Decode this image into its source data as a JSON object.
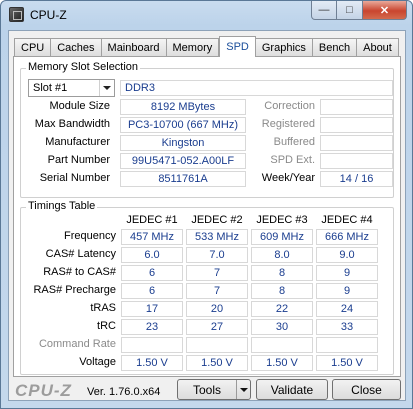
{
  "window": {
    "title": "CPU-Z",
    "min_glyph": "—",
    "max_glyph": "□",
    "close_glyph": "✕"
  },
  "tabs": [
    {
      "label": "CPU"
    },
    {
      "label": "Caches"
    },
    {
      "label": "Mainboard"
    },
    {
      "label": "Memory"
    },
    {
      "label": "SPD",
      "active": true
    },
    {
      "label": "Graphics"
    },
    {
      "label": "Bench"
    },
    {
      "label": "About"
    }
  ],
  "slot": {
    "group_label": "Memory Slot Selection",
    "selected": "Slot #1",
    "type": "DDR3",
    "fields": [
      {
        "label": "Module Size",
        "value": "8192 MBytes"
      },
      {
        "label": "Max Bandwidth",
        "value": "PC3-10700 (667 MHz)"
      },
      {
        "label": "Manufacturer",
        "value": "Kingston"
      },
      {
        "label": "Part Number",
        "value": "99U5471-052.A00LF"
      },
      {
        "label": "Serial Number",
        "value": "8511761A"
      }
    ],
    "right_fields": [
      {
        "label": "Correction",
        "value": ""
      },
      {
        "label": "Registered",
        "value": ""
      },
      {
        "label": "Buffered",
        "value": ""
      },
      {
        "label": "SPD Ext.",
        "value": ""
      },
      {
        "label": "Week/Year",
        "value": "14 / 16"
      }
    ]
  },
  "timings": {
    "group_label": "Timings Table",
    "columns": [
      "JEDEC #1",
      "JEDEC #2",
      "JEDEC #3",
      "JEDEC #4"
    ],
    "rows": [
      {
        "label": "Frequency",
        "values": [
          "457 MHz",
          "533 MHz",
          "609 MHz",
          "666 MHz"
        ]
      },
      {
        "label": "CAS# Latency",
        "values": [
          "6.0",
          "7.0",
          "8.0",
          "9.0"
        ]
      },
      {
        "label": "RAS# to CAS#",
        "values": [
          "6",
          "7",
          "8",
          "9"
        ]
      },
      {
        "label": "RAS# Precharge",
        "values": [
          "6",
          "7",
          "8",
          "9"
        ]
      },
      {
        "label": "tRAS",
        "values": [
          "17",
          "20",
          "22",
          "24"
        ]
      },
      {
        "label": "tRC",
        "values": [
          "23",
          "27",
          "30",
          "33"
        ]
      },
      {
        "label": "Command Rate",
        "values": [
          "",
          "",
          "",
          ""
        ],
        "disabled": true
      },
      {
        "label": "Voltage",
        "values": [
          "1.50 V",
          "1.50 V",
          "1.50 V",
          "1.50 V"
        ]
      }
    ]
  },
  "footer": {
    "logo": "CPU-Z",
    "version": "Ver. 1.76.0.x64",
    "tools_label": "Tools",
    "validate_label": "Validate",
    "close_label": "Close"
  }
}
